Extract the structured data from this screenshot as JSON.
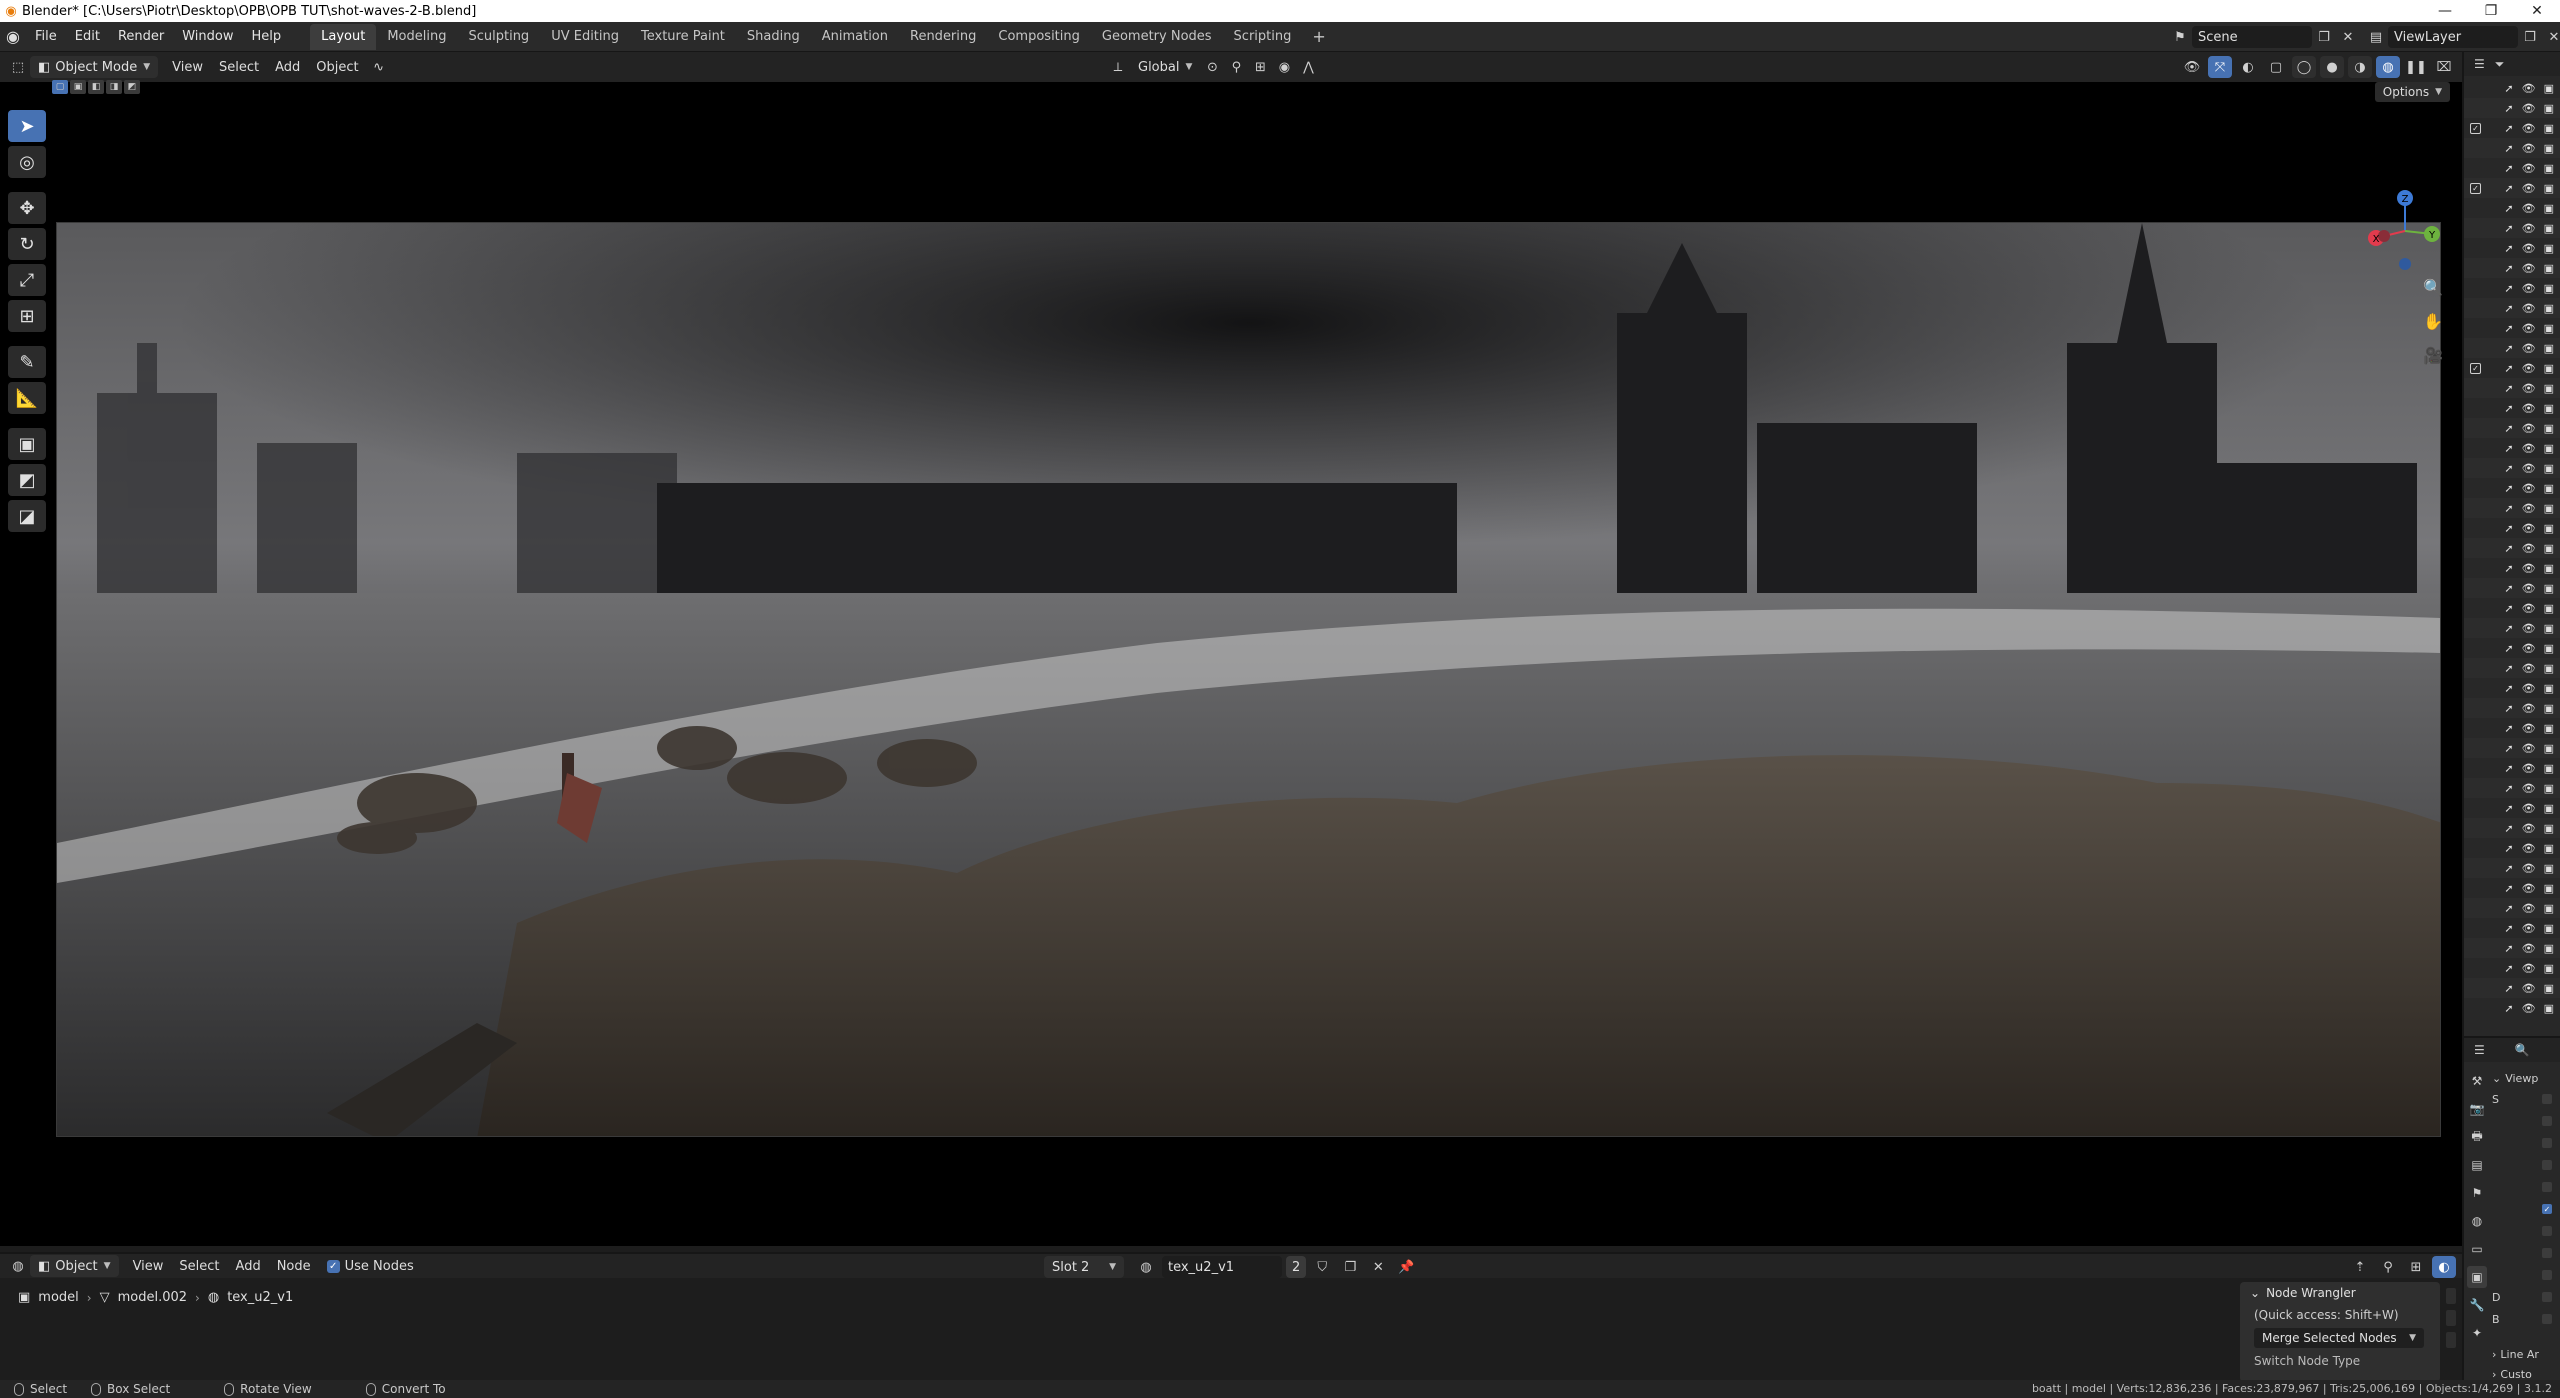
{
  "window": {
    "title": "Blender* [C:\\Users\\Piotr\\Desktop\\OPB\\OPB TUT\\shot-waves-2-B.blend]",
    "minimize_glyph": "—",
    "maximize_glyph": "❐",
    "close_glyph": "✕"
  },
  "topbar": {
    "menus": [
      "File",
      "Edit",
      "Render",
      "Window",
      "Help"
    ],
    "workspaces": [
      "Layout",
      "Modeling",
      "Sculpting",
      "UV Editing",
      "Texture Paint",
      "Shading",
      "Animation",
      "Rendering",
      "Compositing",
      "Geometry Nodes",
      "Scripting"
    ],
    "active_workspace": "Layout",
    "add_tab_glyph": "+",
    "scene_label": "Scene",
    "view_layer_label": "ViewLayer"
  },
  "viewport_header": {
    "mode": "Object Mode",
    "menus": [
      "View",
      "Select",
      "Add",
      "Object"
    ],
    "transform_orientation": "Global",
    "options_label": "Options"
  },
  "toolbar": {
    "tools": [
      {
        "name": "select-box-tool",
        "glyph": "➤",
        "active": true
      },
      {
        "name": "cursor-tool",
        "glyph": "◎",
        "active": false
      },
      {
        "name": "move-tool",
        "glyph": "✥",
        "active": false
      },
      {
        "name": "rotate-tool",
        "glyph": "↻",
        "active": false
      },
      {
        "name": "scale-tool",
        "glyph": "⤢",
        "active": false
      },
      {
        "name": "transform-tool",
        "glyph": "⊞",
        "active": false
      },
      {
        "name": "annotate-tool",
        "glyph": "✎",
        "active": false
      },
      {
        "name": "measure-tool",
        "glyph": "📐",
        "active": false
      },
      {
        "name": "add-cube-tool",
        "glyph": "▣",
        "active": false
      },
      {
        "name": "extra-tool-1",
        "glyph": "◩",
        "active": false
      },
      {
        "name": "extra-tool-2",
        "glyph": "◪",
        "active": false
      }
    ]
  },
  "gizmo": {
    "x_label": "X",
    "y_label": "Y",
    "z_label": "Z",
    "x_color": "#e23b4d",
    "y_color": "#6db33f",
    "z_color": "#3d7ad6"
  },
  "outliner": {
    "row_count": 47,
    "checked_rows": [
      2,
      5,
      14
    ]
  },
  "properties": {
    "section_label": "Viewp",
    "rows": [
      "S",
      "",
      "",
      "",
      "",
      "",
      "",
      "",
      "",
      "D",
      "B"
    ],
    "line_art_label": "Line Ar",
    "custom_label": "Custo"
  },
  "shader_editor": {
    "object_mode": "Object",
    "menus": [
      "View",
      "Select",
      "Add",
      "Node"
    ],
    "use_nodes_label": "Use Nodes",
    "slot": "Slot 2",
    "material_name": "tex_u2_v1",
    "user_count": "2",
    "breadcrumb": [
      "model",
      "model.002",
      "tex_u2_v1"
    ]
  },
  "node_wrangler": {
    "title": "Node Wrangler",
    "hint": "(Quick access: Shift+W)",
    "dropdown": "Merge Selected Nodes",
    "next_item": "Switch Node Type"
  },
  "statusbar": {
    "hints": [
      {
        "icon": "mouse-left",
        "label": "Select"
      },
      {
        "icon": "mouse-left-drag",
        "label": "Box Select"
      },
      {
        "icon": "mouse-middle",
        "label": "Rotate View"
      },
      {
        "icon": "mouse-right",
        "label": "Convert To"
      }
    ],
    "stats": "boatt | model | Verts:12,836,236 | Faces:23,879,967 | Tris:25,006,169 | Objects:1/4,269 | 3.1.2"
  }
}
